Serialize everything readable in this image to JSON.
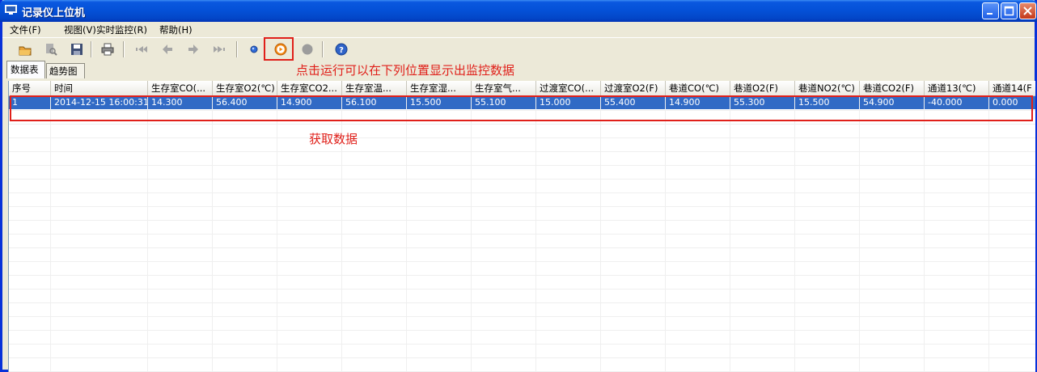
{
  "window": {
    "title": "记录仪上位机"
  },
  "menu": [
    {
      "label": "文件(F)"
    },
    {
      "label": "视图(V)"
    },
    {
      "label": "实时监控(R)"
    },
    {
      "label": "帮助(H)"
    }
  ],
  "toolbar": {
    "buttons": [
      "open-icon",
      "preview-icon",
      "save-icon",
      "print-icon",
      "first-icon",
      "prev-icon",
      "next-icon",
      "last-icon",
      "connect-icon",
      "run-icon",
      "stop-icon",
      "help-icon"
    ]
  },
  "annotations": {
    "run_hint": "点击运行可以在下列位置显示出监控数据",
    "data_hint": "获取数据",
    "highlight_color": "#E0201A"
  },
  "tabs": [
    {
      "label": "数据表",
      "active": true
    },
    {
      "label": "趋势图",
      "active": false
    }
  ],
  "table": {
    "columns": [
      "序号",
      "时间",
      "生存室CO(...",
      "生存室O2(℃)",
      "生存室CO2...",
      "生存室温...",
      "生存室湿...",
      "生存室气...",
      "过渡室CO(...",
      "过渡室O2(F)",
      "巷道CO(℃)",
      "巷道O2(F)",
      "巷道NO2(℃)",
      "巷道CO2(F)",
      "通道13(℃)",
      "通道14(F"
    ],
    "rows": [
      [
        "1",
        "2014-12-15 16:00:31",
        "14.300",
        "56.400",
        "14.900",
        "56.100",
        "15.500",
        "55.100",
        "15.000",
        "55.400",
        "14.900",
        "55.300",
        "15.500",
        "54.900",
        "-40.000",
        "0.000"
      ]
    ],
    "selection_color": "#316AC5"
  }
}
